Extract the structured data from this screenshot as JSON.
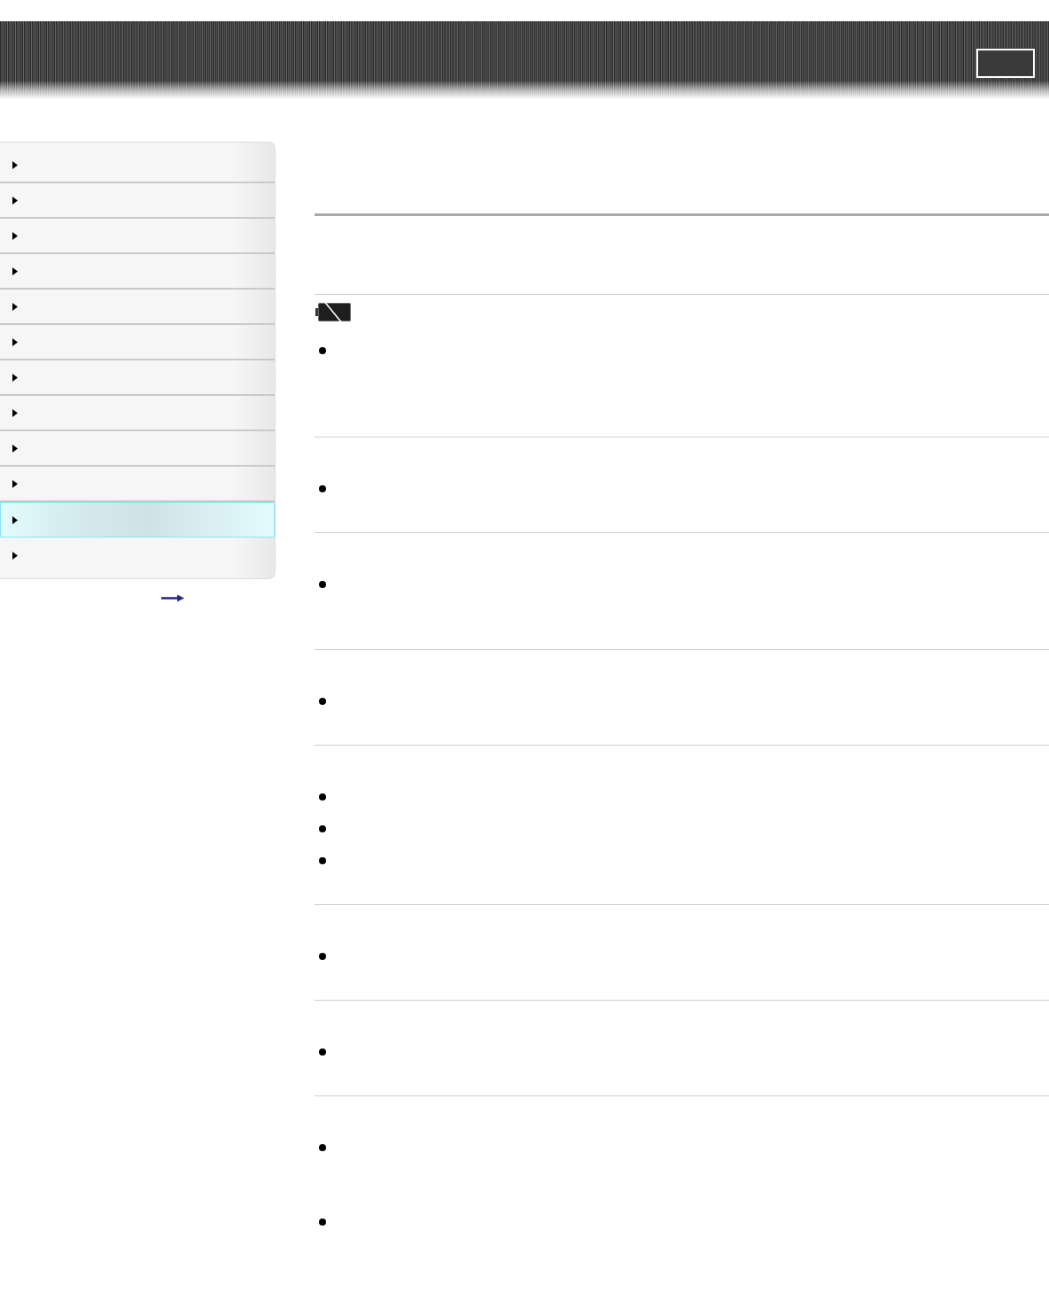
{
  "header": {
    "controls": [
      {
        "kind": "button"
      }
    ]
  },
  "sidebar": {
    "items": [
      {
        "selected": false
      },
      {
        "selected": false
      },
      {
        "selected": false
      },
      {
        "selected": false
      },
      {
        "selected": false
      },
      {
        "selected": false
      },
      {
        "selected": false
      },
      {
        "selected": false
      },
      {
        "selected": false
      },
      {
        "selected": false
      },
      {
        "selected": true
      },
      {
        "selected": false
      }
    ],
    "links": [
      {
        "kind": "link"
      }
    ]
  },
  "content": {
    "sections": [
      {
        "kind": "icon",
        "items": [
          {
            "kind": "bullet"
          }
        ]
      },
      {
        "kind": "plain",
        "items": [
          {
            "kind": "bullet"
          }
        ]
      },
      {
        "kind": "plain",
        "items": [
          {
            "kind": "bullet"
          }
        ]
      },
      {
        "kind": "plain",
        "items": [
          {
            "kind": "bullet"
          }
        ]
      },
      {
        "kind": "plain",
        "items": [
          {
            "kind": "bullet"
          },
          {
            "kind": "bullet"
          },
          {
            "kind": "bullet"
          }
        ]
      },
      {
        "kind": "plain",
        "items": [
          {
            "kind": "bullet"
          }
        ]
      },
      {
        "kind": "plain",
        "items": [
          {
            "kind": "bullet"
          }
        ]
      },
      {
        "kind": "plain",
        "items": [
          {
            "kind": "bullet"
          },
          {
            "kind": "bullet"
          }
        ]
      }
    ]
  }
}
